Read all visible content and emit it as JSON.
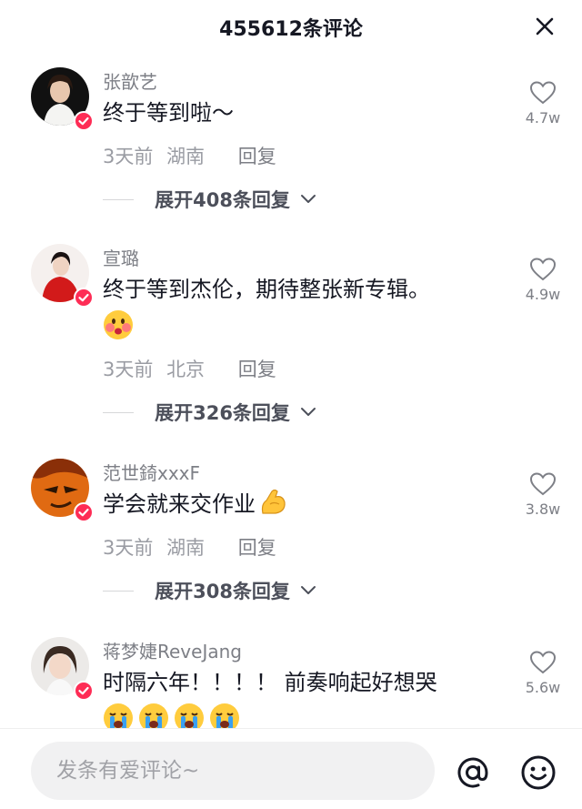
{
  "header": {
    "title": "455612条评论"
  },
  "comments": [
    {
      "username": "张歆艺",
      "text": "终于等到啦～",
      "time": "3天前",
      "location": "湖南",
      "reply_label": "回复",
      "expand_label": "展开408条回复",
      "likes": "4.7w",
      "emojis": []
    },
    {
      "username": "宣璐",
      "text": "终于等到杰伦，期待整张新专辑。",
      "time": "3天前",
      "location": "北京",
      "reply_label": "回复",
      "expand_label": "展开326条回复",
      "likes": "4.9w",
      "emojis": [
        "blush-face-icon"
      ]
    },
    {
      "username": "范世錡xxxF",
      "text": "学会就来交作业",
      "time": "3天前",
      "location": "湖南",
      "reply_label": "回复",
      "expand_label": "展开308条回复",
      "likes": "3.8w",
      "emojis": [
        "flexed-biceps-icon"
      ]
    },
    {
      "username": "蒋梦婕ReveJang",
      "text": "时隔六年！！！！ 前奏响起好想哭",
      "likes": "5.6w",
      "emojis": [
        "crying-face-icon",
        "crying-face-icon",
        "crying-face-icon",
        "crying-face-icon"
      ]
    }
  ],
  "footer": {
    "input_placeholder": "发条有爱评论~"
  },
  "colors": {
    "accent": "#fe2c55",
    "muted_text": "#7d7f86",
    "primary_text": "#161823"
  }
}
